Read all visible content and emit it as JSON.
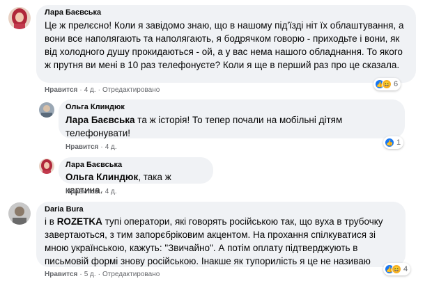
{
  "comments": [
    {
      "author": "Лара Баєвська",
      "text": "Це ж прелєсно! Коли я завідомо знаю, що в нашому під'їзді ніт їх облаштування, а вони все наполягають та наполягають, я бодрячком говорю - приходьте і вони, як від холодного душу прокидаються - ой, а у вас нема нашого обладнання. То якого ж прутня ви мені в 10 раз телефонуєте? Коли я ще в перший раз про це сказала.",
      "like": "Нравится",
      "time": "4 д.",
      "edited": "Отредактировано",
      "reactions": "6"
    },
    {
      "author": "Ольга Клиндюк",
      "mention": "Лара Баєвська",
      "text": " та ж історія! То тепер почали на мобільні дітям телефонувати!",
      "like": "Нравится",
      "time": "4 д.",
      "reactions": "1"
    },
    {
      "author": "Лара Баєвська",
      "mention": "Ольга Клиндюк",
      "text": ", така ж картина.",
      "like": "Нравится",
      "time": "4 д."
    },
    {
      "author": "Daria Bura",
      "text_pre": "і в ",
      "text_bold": "ROZETKA",
      "text_post": " тупі оператори, які говорять російською так, що вуха в трубочку завертаються, з тим запорєбріковим акцентом. На прохання спілкуватися зі мною українською, кажуть: \"Звичайно\". А потім оплату підтверджують в письмовій формі знову російською. Інакше як тупорилість я це не називаю",
      "like": "Нравится",
      "time": "5 д.",
      "edited": "Отредактировано",
      "reactions": "4"
    }
  ],
  "colors": {
    "bubble": "#f0f2f5",
    "meta": "#65676b",
    "like": "#1877f2",
    "haha": "#f7b125"
  },
  "icons": {
    "like": "thumbs-up-icon",
    "haha": "haha-icon"
  }
}
